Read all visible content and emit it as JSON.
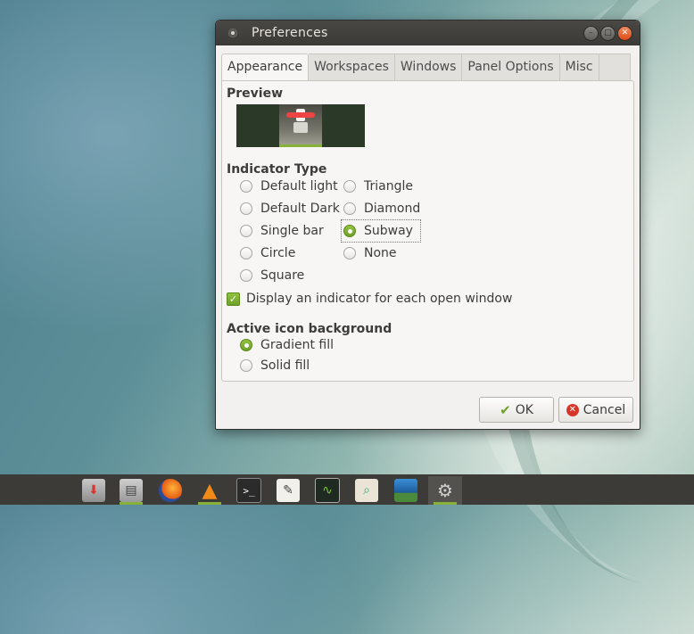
{
  "window": {
    "title": "Preferences",
    "controls": [
      "minimize",
      "maximize",
      "close"
    ]
  },
  "tabs": [
    {
      "label": "Appearance",
      "active": true
    },
    {
      "label": "Workspaces",
      "active": false
    },
    {
      "label": "Windows",
      "active": false
    },
    {
      "label": "Panel Options",
      "active": false
    },
    {
      "label": "Misc",
      "active": false
    }
  ],
  "appearance": {
    "preview_label": "Preview",
    "indicator_type_label": "Indicator Type",
    "indicator_options": {
      "default_light": "Default light",
      "default_dark": "Default Dark",
      "single_bar": "Single bar",
      "circle": "Circle",
      "square": "Square",
      "triangle": "Triangle",
      "diamond": "Diamond",
      "subway": "Subway",
      "none": "None"
    },
    "indicator_selected": "Subway",
    "display_indicator_label": "Display an indicator for each open window",
    "display_indicator_checked": true,
    "active_bg_label": "Active icon background",
    "active_bg_options": {
      "gradient": "Gradient fill",
      "solid": "Solid fill"
    },
    "active_bg_selected": "Gradient fill"
  },
  "buttons": {
    "ok": "OK",
    "cancel": "Cancel"
  },
  "taskbar": {
    "items": [
      "download-manager-icon",
      "file-manager-icon",
      "firefox-icon",
      "vlc-icon",
      "terminal-icon",
      "text-editor-icon",
      "system-monitor-icon",
      "image-viewer-icon",
      "photo-icon",
      "settings-icon"
    ]
  },
  "colors": {
    "accent": "#88b13a",
    "titlebar": "#3b3a37",
    "close": "#df4b16"
  }
}
